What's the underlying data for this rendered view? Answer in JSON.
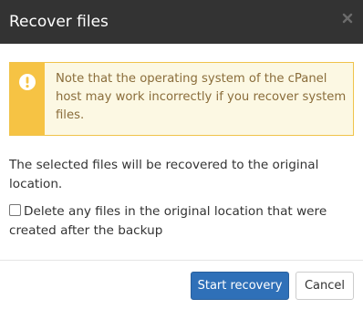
{
  "dialog": {
    "title": "Recover files",
    "close_icon": "close-icon"
  },
  "alert": {
    "icon": "exclamation-circle-icon",
    "text": "Note that the operating system of the cPanel host may work incorrectly if you recover system files.",
    "colors": {
      "background": "#fcf8e3",
      "border": "#f0c34a",
      "icon_bar": "#f6c344",
      "text": "#8a6d3b"
    }
  },
  "body": {
    "description": "The selected files will be recovered to the original location.",
    "delete_checkbox": {
      "label": "Delete any files in the original location that were created after the backup",
      "checked": false
    }
  },
  "footer": {
    "start_label": "Start recovery",
    "cancel_label": "Cancel"
  },
  "colors": {
    "header": "#333333",
    "primary": "#2f70b8"
  }
}
